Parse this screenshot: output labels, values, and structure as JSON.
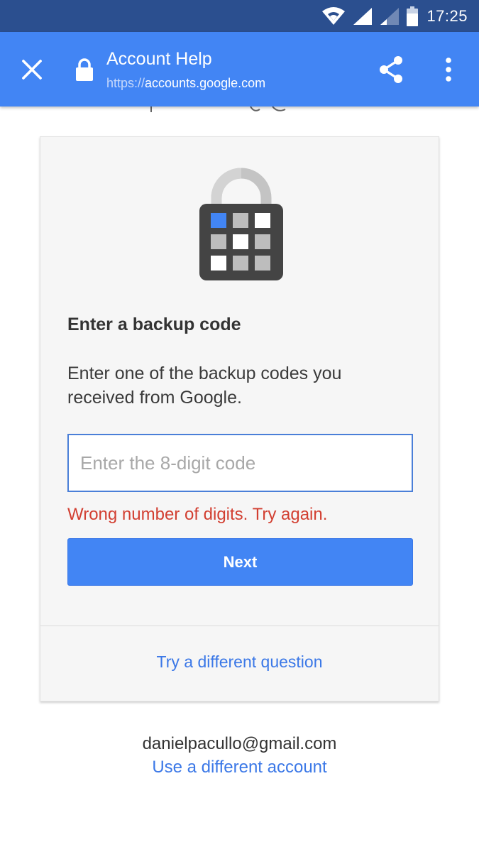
{
  "status_bar": {
    "time": "17:25",
    "icons": [
      "wifi-icon",
      "signal-icon",
      "signal-weak-icon",
      "battery-icon"
    ]
  },
  "toolbar": {
    "title": "Account Help",
    "url_scheme": "https://",
    "url_host": "accounts.google.com",
    "icons": [
      "close-icon",
      "lock-icon",
      "share-icon",
      "more-vert-icon"
    ]
  },
  "card": {
    "heading": "Enter a backup code",
    "description": "Enter one of the backup codes you received from Google.",
    "input": {
      "placeholder": "Enter the 8-digit code",
      "value": ""
    },
    "error": "Wrong number of digits. Try again.",
    "next_label": "Next",
    "alt_link": "Try a different question"
  },
  "account": {
    "email": "danielpacullo@gmail.com",
    "switch_label": "Use a different account"
  },
  "colors": {
    "toolbar": "#4285f4",
    "status_bar": "#2b4f8f",
    "error": "#d23f31",
    "link": "#3b78e7"
  }
}
